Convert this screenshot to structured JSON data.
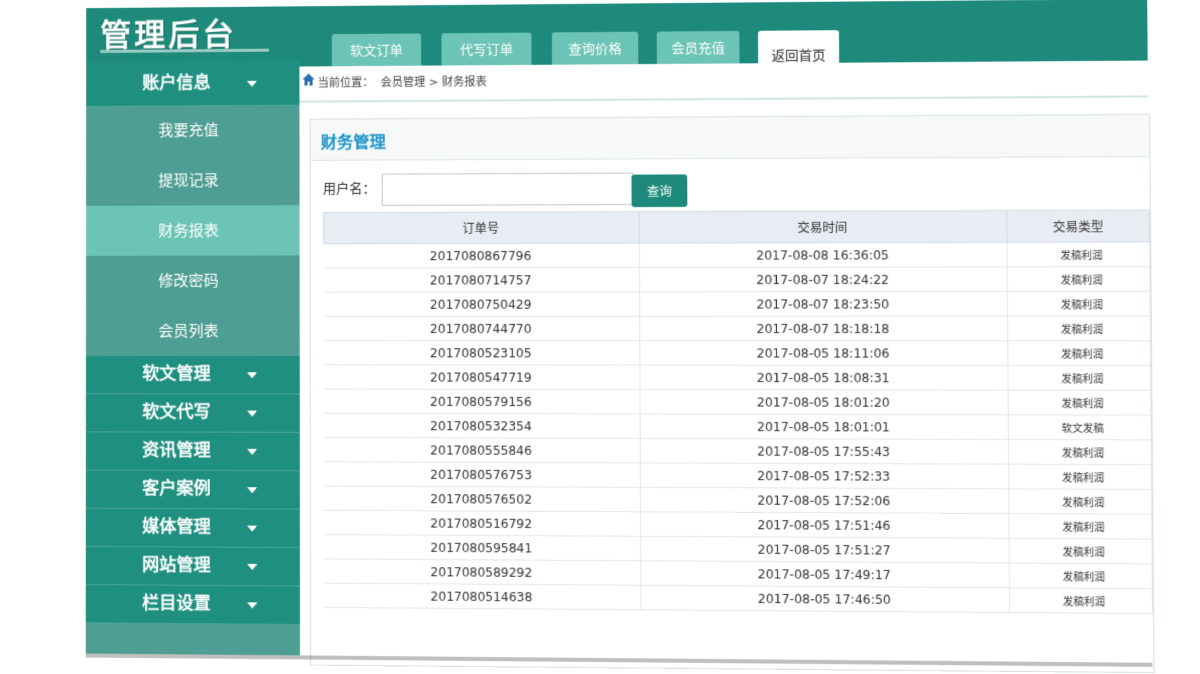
{
  "app": {
    "title": "管理后台"
  },
  "tabs": [
    {
      "label": "软文订单"
    },
    {
      "label": "代写订单"
    },
    {
      "label": "查询价格"
    },
    {
      "label": "会员充值"
    },
    {
      "label": "返回首页"
    }
  ],
  "breadcrumb": {
    "prefix": "当前位置：",
    "path": "会员管理 > 财务报表"
  },
  "sidebar": {
    "account": {
      "label": "账户信息"
    },
    "sub_items": [
      {
        "label": "我要充值"
      },
      {
        "label": "提现记录"
      },
      {
        "label": "财务报表"
      },
      {
        "label": "修改密码"
      },
      {
        "label": "会员列表"
      }
    ],
    "groups": [
      {
        "label": "软文管理"
      },
      {
        "label": "软文代写"
      },
      {
        "label": "资讯管理"
      },
      {
        "label": "客户案例"
      },
      {
        "label": "媒体管理"
      },
      {
        "label": "网站管理"
      },
      {
        "label": "栏目设置"
      }
    ]
  },
  "panel": {
    "title": "财务管理"
  },
  "search": {
    "label": "用户名：",
    "value": "",
    "placeholder": "",
    "button": "查询"
  },
  "table": {
    "headers": [
      "订单号",
      "交易时间",
      "交易类型"
    ],
    "rows": [
      [
        "2017080867796",
        "2017-08-08 16:36:05",
        "发稿利润"
      ],
      [
        "2017080714757",
        "2017-08-07 18:24:22",
        "发稿利润"
      ],
      [
        "2017080750429",
        "2017-08-07 18:23:50",
        "发稿利润"
      ],
      [
        "2017080744770",
        "2017-08-07 18:18:18",
        "发稿利润"
      ],
      [
        "2017080523105",
        "2017-08-05 18:11:06",
        "发稿利润"
      ],
      [
        "2017080547719",
        "2017-08-05 18:08:31",
        "发稿利润"
      ],
      [
        "2017080579156",
        "2017-08-05 18:01:20",
        "发稿利润"
      ],
      [
        "2017080532354",
        "2017-08-05 18:01:01",
        "软文发稿"
      ],
      [
        "2017080555846",
        "2017-08-05 17:55:43",
        "发稿利润"
      ],
      [
        "2017080576753",
        "2017-08-05 17:52:33",
        "发稿利润"
      ],
      [
        "2017080576502",
        "2017-08-05 17:52:06",
        "发稿利润"
      ],
      [
        "2017080516792",
        "2017-08-05 17:51:46",
        "发稿利润"
      ],
      [
        "2017080595841",
        "2017-08-05 17:51:27",
        "发稿利润"
      ],
      [
        "2017080589292",
        "2017-08-05 17:49:17",
        "发稿利润"
      ],
      [
        "2017080514638",
        "2017-08-05 17:46:50",
        "发稿利润"
      ]
    ]
  },
  "colors": {
    "primary": "#1d8a7c",
    "tab": "#6cc4b6",
    "active": "#6cc4b6",
    "title": "#1c93c9"
  }
}
